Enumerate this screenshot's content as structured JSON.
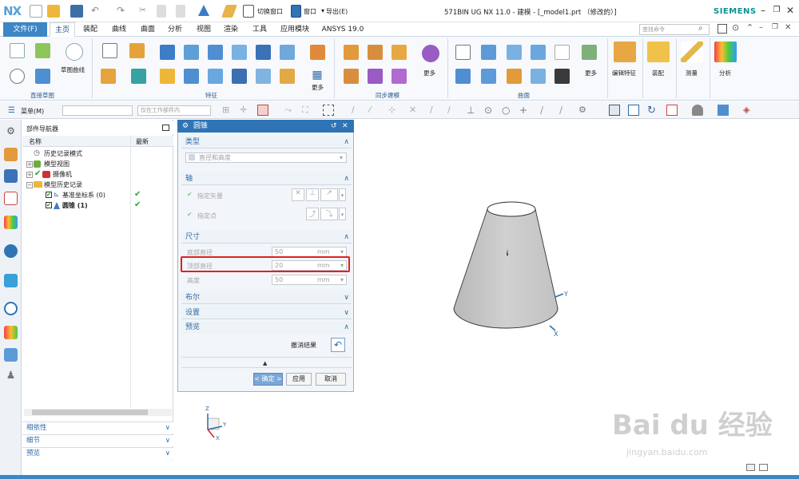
{
  "app": {
    "logo": "NX",
    "window_title": "571BIN UG NX 11.0 - 建模 - [_model1.prt （修改的）]",
    "brand": "SIEMENS",
    "switch_window": "切换窗口",
    "window_menu": "窗口",
    "export_menu": "导出(E)"
  },
  "tabs": [
    "文件(F)",
    "主页",
    "装配",
    "曲线",
    "曲面",
    "分析",
    "视图",
    "渲染",
    "工具",
    "应用模块",
    "ANSYS 19.0"
  ],
  "command_search": {
    "placeholder": "查找命令"
  },
  "ribbon": {
    "groups": [
      "直接草图",
      "特征",
      "同步建模",
      "曲面"
    ],
    "sketch_curve": "草图曲线",
    "more": "更多",
    "large_buttons": [
      "编辑特征",
      "装配",
      "测量",
      "分析"
    ]
  },
  "toolbar": {
    "menu": "菜单(M)",
    "filter_placeholder": "",
    "scope": "仅在工作部件内"
  },
  "navigator": {
    "title": "部件导航器",
    "col_name": "名称",
    "col_latest": "最新",
    "items": [
      {
        "label": "历史记录模式",
        "latest": ""
      },
      {
        "label": "模型视图",
        "latest": ""
      },
      {
        "label": "摄像机",
        "latest": ""
      },
      {
        "label": "模型历史记录",
        "latest": ""
      },
      {
        "label": "基准坐标系 (0)",
        "latest": "✔"
      },
      {
        "label": "圆锥 (1)",
        "latest": "✔"
      }
    ],
    "sections": [
      "相依性",
      "细节",
      "预览"
    ]
  },
  "dialog": {
    "title": "圆锥",
    "type_section": "类型",
    "type_value": "直径和高度",
    "axis_section": "轴",
    "vector_label": "指定矢量",
    "point_label": "指定点",
    "dim_section": "尺寸",
    "base_label": "底部直径",
    "base_value": "50",
    "top_label": "顶部直径",
    "top_value": "20",
    "height_label": "高度",
    "height_value": "50",
    "unit": "mm",
    "bool_section": "布尔",
    "settings_section": "设置",
    "preview_section": "预览",
    "undo_result": "撤消结果",
    "ok": "< 确定 >",
    "apply": "应用",
    "cancel": "取消"
  },
  "viewport": {
    "axis_y": "Y",
    "axis_x": "X",
    "triad_z": "Z",
    "triad_y": "Y",
    "triad_x": "X"
  },
  "watermark": {
    "text": "Bai du 经验",
    "url": "jingyan.baidu.com"
  },
  "colors": {
    "accent": "#3c86c6",
    "highlight": "#e02020"
  }
}
